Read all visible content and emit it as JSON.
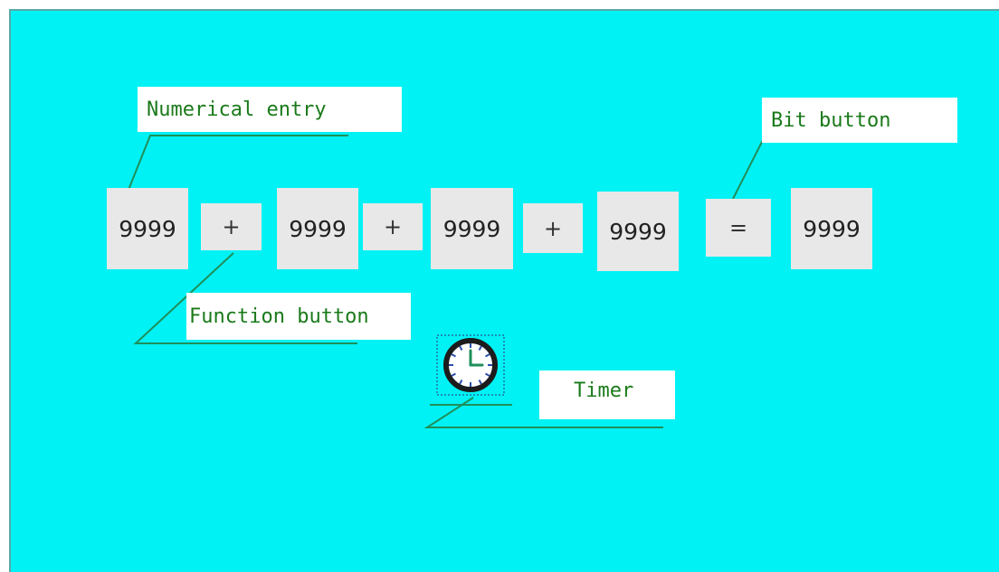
{
  "labels": {
    "numerical_entry": "Numerical entry",
    "bit_button": "Bit button",
    "function_button": "Function button",
    "timer": "Timer"
  },
  "equation": {
    "entry_1": "9999",
    "op_1": "+",
    "entry_2": "9999",
    "op_2": "+",
    "entry_3": "9999",
    "op_3": "+",
    "entry_4": "9999",
    "equals": "=",
    "result": "9999"
  },
  "icons": {
    "timer": "clock-icon"
  },
  "colors": {
    "screen_background": "#00f2f4",
    "cell_background": "#e8e8e8",
    "label_text": "#1a7a1a",
    "leader_line": "#1f8f5a"
  }
}
